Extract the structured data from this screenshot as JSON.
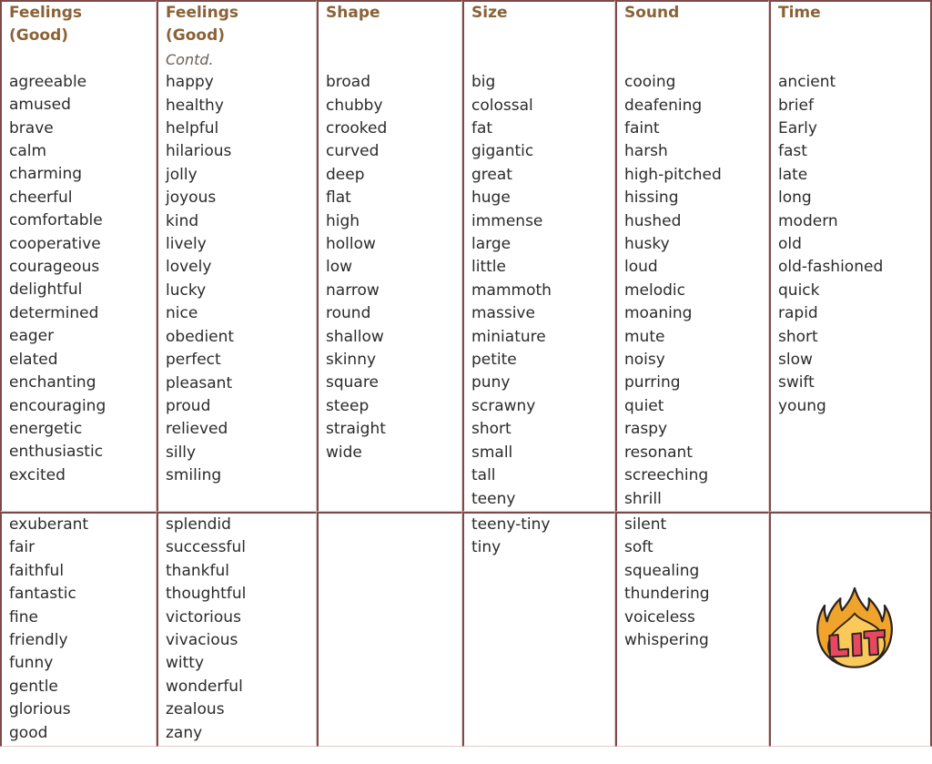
{
  "document": {
    "kind": "adjectives-word-bank-table",
    "column_count": 6
  },
  "columns": [
    {
      "id": "feelings-good-1",
      "title": "Feelings",
      "subtitle": "(Good)",
      "note": "",
      "words_block1": [
        "agreeable",
        "amused",
        "brave",
        "calm",
        "charming",
        "cheerful",
        "comfortable",
        "cooperative",
        "courageous",
        "delightful",
        "determined",
        "eager",
        "elated",
        "enchanting",
        "encouraging",
        "energetic",
        "enthusiastic",
        "excited"
      ],
      "words_block2": [
        "exuberant",
        "fair",
        "faithful",
        "fantastic",
        "fine",
        "friendly",
        "funny",
        "gentle",
        "glorious",
        "good"
      ]
    },
    {
      "id": "feelings-good-2",
      "title": "Feelings",
      "subtitle": "(Good)",
      "note": "Contd.",
      "words_block1": [
        "happy",
        "healthy",
        "helpful",
        "hilarious",
        "jolly",
        "joyous",
        "kind",
        "lively",
        "lovely",
        "lucky",
        "nice",
        "obedient",
        "perfect",
        "pleasant",
        "proud",
        "relieved",
        "silly",
        "smiling"
      ],
      "words_block2": [
        "splendid",
        "successful",
        "thankful",
        "thoughtful",
        "victorious",
        "vivacious",
        "witty",
        "wonderful",
        "zealous",
        "zany"
      ]
    },
    {
      "id": "shape",
      "title": "Shape",
      "subtitle": "",
      "note": "",
      "words_block1": [
        "broad",
        "chubby",
        "crooked",
        "curved",
        "deep",
        "flat",
        "high",
        "hollow",
        "low",
        "narrow",
        "round",
        "shallow",
        "skinny",
        "square",
        "steep",
        "straight",
        "wide"
      ],
      "words_block2": []
    },
    {
      "id": "size",
      "title": "Size",
      "subtitle": "",
      "note": "",
      "words_block1": [
        "big",
        "colossal",
        "fat",
        "gigantic",
        "great",
        "huge",
        "immense",
        "large",
        "little",
        "mammoth",
        "massive",
        "miniature",
        "petite",
        "puny",
        "scrawny",
        "short",
        "small",
        "tall",
        "teeny"
      ],
      "words_block2": [
        "teeny-tiny",
        "tiny"
      ]
    },
    {
      "id": "sound",
      "title": "Sound",
      "subtitle": "",
      "note": "",
      "words_block1": [
        "cooing",
        "deafening",
        "faint",
        "harsh",
        "high-pitched",
        "hissing",
        "hushed",
        "husky",
        "loud",
        "melodic",
        "moaning",
        "mute",
        "noisy",
        "purring",
        "quiet",
        "raspy",
        "resonant",
        "screeching",
        "shrill"
      ],
      "words_block2": [
        "silent",
        "soft",
        "squealing",
        "thundering",
        "voiceless",
        "whispering"
      ]
    },
    {
      "id": "time",
      "title": "Time",
      "subtitle": "",
      "note": "",
      "words_block1": [
        "ancient",
        "brief",
        "Early",
        "fast",
        "late",
        "long",
        "modern",
        "old",
        "old-fashioned",
        "quick",
        "rapid",
        "short",
        "slow",
        "swift",
        "young"
      ],
      "words_block2": []
    }
  ],
  "decorations": {
    "lit_emoji": {
      "name": "fire-lit-emoji",
      "label": "LIT",
      "flame_outer_color": "#f0a02a",
      "flame_inner_color": "#fbc95a",
      "text_color": "#e8485f",
      "outline_color": "#2b2320"
    }
  },
  "colors": {
    "header_text": "#8a6237",
    "body_text": "#2b2b2b",
    "border_dark": "#7d4a4a",
    "border_light": "#e3cdcd",
    "background": "#ffffff",
    "note_text": "#6e6054"
  }
}
